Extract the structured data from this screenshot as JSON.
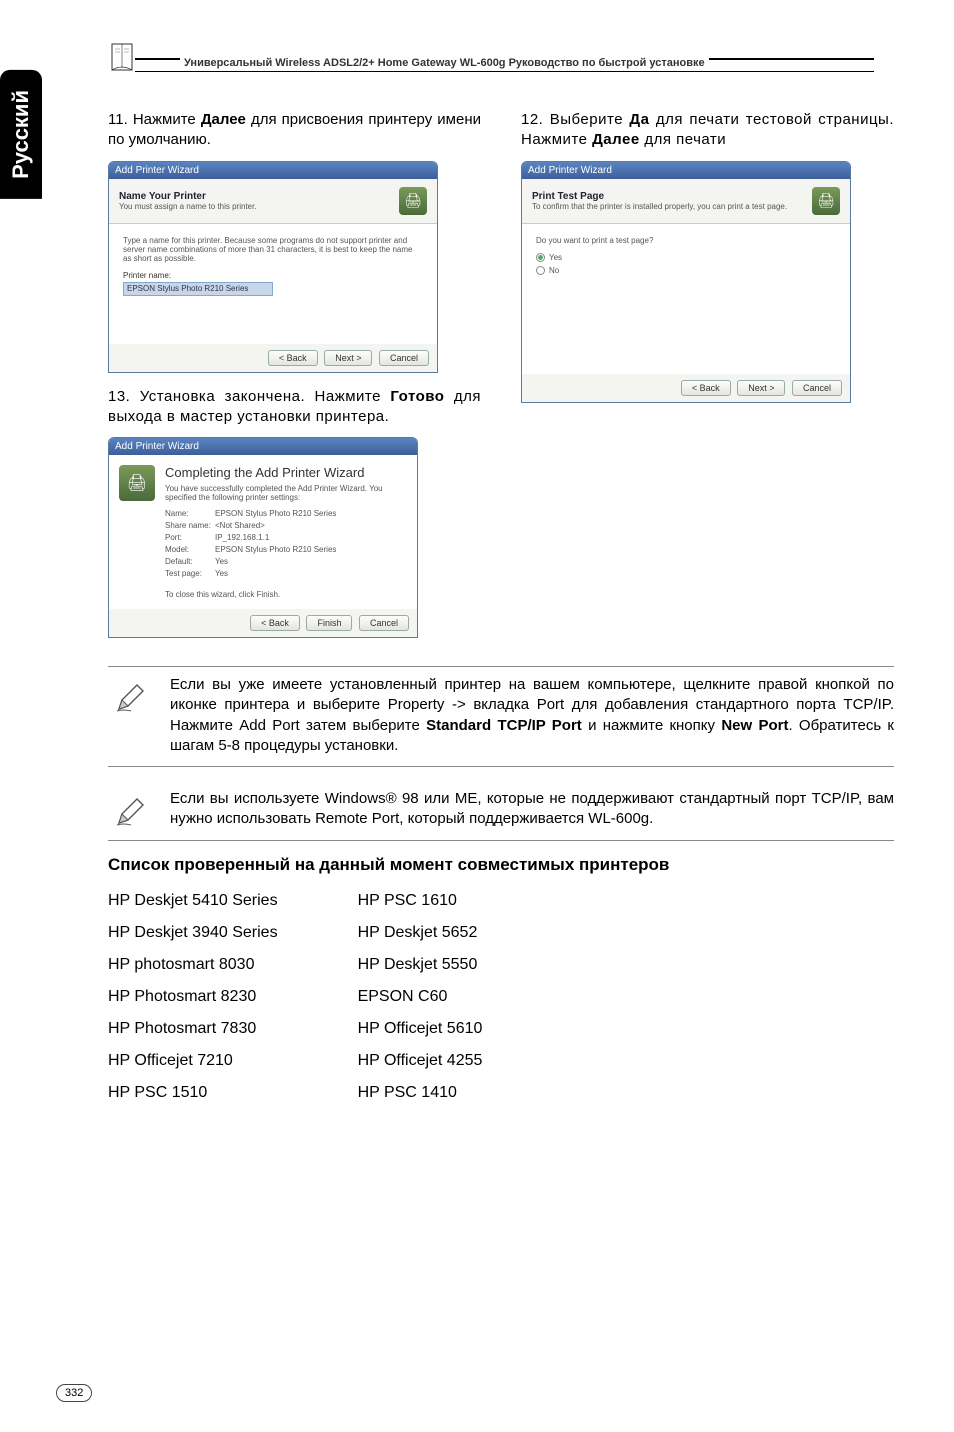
{
  "sidebar_label": "Русский",
  "header_line": "Универсальный Wireless ADSL2/2+ Home Gateway  WL-600g Руководство по быстрой установке",
  "step11": {
    "prefix": "11. Нажмите ",
    "bold": "Далее",
    "suffix": " для присвоения принтеру имени по умолчанию."
  },
  "step12": {
    "prefix": "12. Выберите ",
    "bold1": "Да",
    "mid": " для печати тестовой страницы. Нажмите ",
    "bold2": "Далее",
    "suffix": " для печати"
  },
  "step13": {
    "prefix": "13. Установка закончена. Нажмите ",
    "bold": "Готово",
    "suffix": " для выхода в мастер установки принтера."
  },
  "dialog_common": {
    "titlebar": "Add Printer Wizard",
    "btn_back": "< Back",
    "btn_next": "Next >",
    "btn_cancel": "Cancel",
    "btn_finish": "Finish"
  },
  "dialog11": {
    "title": "Name Your Printer",
    "sub": "You must assign a name to this printer.",
    "body_text": "Type a name for this printer. Because some programs do not support printer and server name combinations of more than 31 characters, it is best to keep the name as short as possible.",
    "field_label": "Printer name:",
    "field_value": "EPSON Stylus Photo R210 Series"
  },
  "dialog12": {
    "title": "Print Test Page",
    "sub": "To confirm that the printer is installed properly, you can print a test page.",
    "question": "Do you want to print a test page?",
    "opt_yes": "Yes",
    "opt_no": "No"
  },
  "dialog13": {
    "title": "Completing the Add Printer Wizard",
    "sub": "You have successfully completed the Add Printer Wizard. You specified the following printer settings:",
    "rows": {
      "Name": "EPSON Stylus Photo R210 Series",
      "Share name": "<Not Shared>",
      "Port": "IP_192.168.1.1",
      "Model": "EPSON Stylus Photo R210 Series",
      "Default": "Yes",
      "Test page": "Yes"
    },
    "closing": "To close this wizard, click Finish."
  },
  "note1": {
    "pre": "Если вы уже имеете установленный принтер на вашем компьютере, щелкните правой кнопкой по иконке принтера и выберите Property -> вкладка Port для добавления стандартного порта TCP/IP. Нажмите Add Port затем выберите ",
    "b1": "Standard TCP/IP Port",
    "mid": " и нажмите кнопку ",
    "b2": "New Port",
    "post": ". Обратитесь к шагам 5-8 процедуры установки."
  },
  "note2": "Если вы используете Windows® 98 или ME, которые не поддерживают стандартный порт TCP/IP, вам нужно использовать Remote Port, который поддерживается WL-600g.",
  "printers_heading": "Список проверенный на данный момент совместимых принтеров",
  "printers_left": [
    "HP Deskjet 5410 Series",
    "HP Deskjet 3940 Series",
    "HP photosmart 8030",
    "HP Photosmart 8230",
    "HP Photosmart 7830",
    "HP Officejet  7210",
    "HP PSC 1510"
  ],
  "printers_right": [
    "HP PSC 1610",
    "HP Deskjet 5652",
    "HP Deskjet 5550",
    "EPSON C60",
    "HP Officejet 5610",
    "HP Officejet 4255",
    "HP  PSC 1410"
  ],
  "page_number": "332"
}
